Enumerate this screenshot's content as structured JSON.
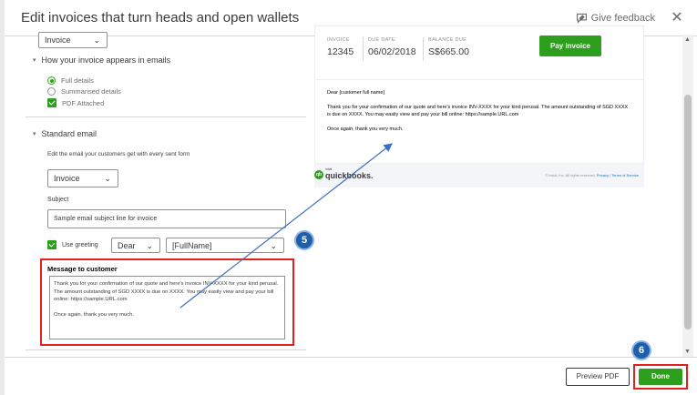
{
  "window": {
    "title": "Edit invoices that turn heads and open wallets",
    "feedback_label": "Give feedback",
    "close_glyph": "✕"
  },
  "left_panel": {
    "form_select": "Invoice",
    "appearance_section": "How your invoice appears in emails",
    "options": [
      {
        "label": "Full details",
        "type": "radio",
        "checked": true
      },
      {
        "label": "Summarised details",
        "type": "radio",
        "checked": false
      },
      {
        "label": "PDF Attached",
        "type": "checkbox",
        "checked": true
      }
    ],
    "email_section": "Standard email",
    "email_hint": "Edit the email your customers get with every sent form",
    "email_form_select": "Invoice",
    "subject_label": "Subject",
    "subject_value": "Sample email subject line for invoice",
    "greeting_label": "Use greeting",
    "greeting_salutation": "Dear",
    "greeting_name": "[FullName]",
    "message_label": "Message to customer",
    "message_para1": "Thank you for your confirmation of our quote and here's invoice INV-XXXX for your kind perusal. The amount outstanding of SGD XXXX is due on XXXX. You may easily view and pay your bill online: https://sample.URL.com",
    "message_para2": "Once again, thank you very much."
  },
  "preview": {
    "invoice_label": "INVOICE",
    "invoice_value": "12345",
    "due_label": "DUE DATE",
    "due_value": "06/02/2018",
    "balance_label": "BALANCE DUE",
    "balance_value": "S$665.00",
    "pay_button": "Pay invoice",
    "greeting": "Dear [customer full name]",
    "body": "Thank you for your confirmation of our quote and here's invoice INV-XXXX for your kind perusal. The amount outstanding of SGD XXXX is due on XXXX. You may easily view and pay your bill online: https://sample.URL.com",
    "closing": "Once again, thank you very much.",
    "brand_small": "intuit",
    "brand": "quickbooks.",
    "brand_badge": "qb",
    "legal_text": "© Intuit, Inc. All rights reserved.",
    "privacy": "Privacy",
    "separator": "|",
    "terms": "Terms of Service"
  },
  "footer": {
    "preview_button": "Preview PDF",
    "done_button": "Done"
  },
  "annotations": {
    "step5": "5",
    "step6": "6"
  },
  "icons": {
    "feedback": "feedback-icon",
    "close": "close-icon",
    "chevron": "chevron-down-icon",
    "caret": "caret-down-icon",
    "scroll_up": "▲",
    "scroll_down": "▼"
  },
  "colors": {
    "accent_green": "#2ca01c",
    "highlight_red": "#e0201d",
    "step_blue": "#1d5fa8"
  }
}
